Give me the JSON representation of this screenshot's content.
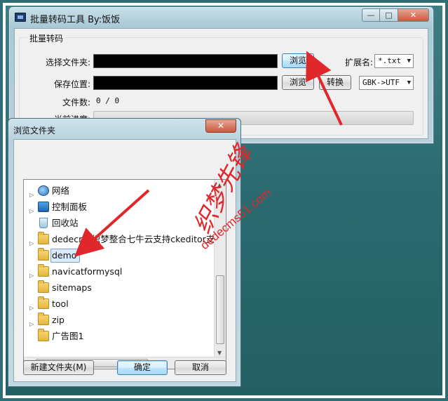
{
  "main_window": {
    "title": "批量转码工具 By:饭饭",
    "caption": {
      "minimize": "—",
      "maximize": "□",
      "close": "✕"
    },
    "group_title": "批量转码",
    "select_folder_label": "选择文件夹:",
    "save_location_label": "保存位置:",
    "file_count_label": "文件数:",
    "file_count_value": "0 / 0",
    "progress_label": "当前进度:",
    "progress_value": 0,
    "browse_button": "浏览",
    "browse_button_2": "浏览",
    "convert_button": "转换",
    "extension_label": "扩展名:",
    "extension_value": "*.txt",
    "encoding_value": "GBK->UTF"
  },
  "browse_dialog": {
    "title": "浏览文件夹",
    "close": "✕",
    "tree_items": [
      {
        "label": "网络",
        "icon": "network-icon",
        "expander": "▷"
      },
      {
        "label": "控制面板",
        "icon": "control-panel-icon",
        "expander": "▷"
      },
      {
        "label": "回收站",
        "icon": "recycle-bin-icon",
        "expander": ""
      },
      {
        "label": "dedecms织梦整合七牛云支持ckeditor支持",
        "icon": "folder-icon",
        "expander": "▷"
      },
      {
        "label": "demo",
        "icon": "folder-icon",
        "expander": "",
        "selected": true
      },
      {
        "label": "navicatformysql",
        "icon": "folder-icon",
        "expander": "▷"
      },
      {
        "label": "sitemaps",
        "icon": "folder-icon",
        "expander": ""
      },
      {
        "label": "tool",
        "icon": "folder-icon",
        "expander": "▷"
      },
      {
        "label": "zip",
        "icon": "folder-icon",
        "expander": "▷"
      },
      {
        "label": "广告图1",
        "icon": "folder-icon",
        "expander": ""
      }
    ],
    "new_folder_button": "新建文件夹(M)",
    "ok_button": "确定",
    "cancel_button": "取消"
  },
  "watermark": {
    "brand": "织梦先锋",
    "url": "dedecms51.com"
  },
  "colors": {
    "annotation_arrow": "#e0282c",
    "selection": "#dcebfc",
    "watermark": "#e0282c"
  }
}
